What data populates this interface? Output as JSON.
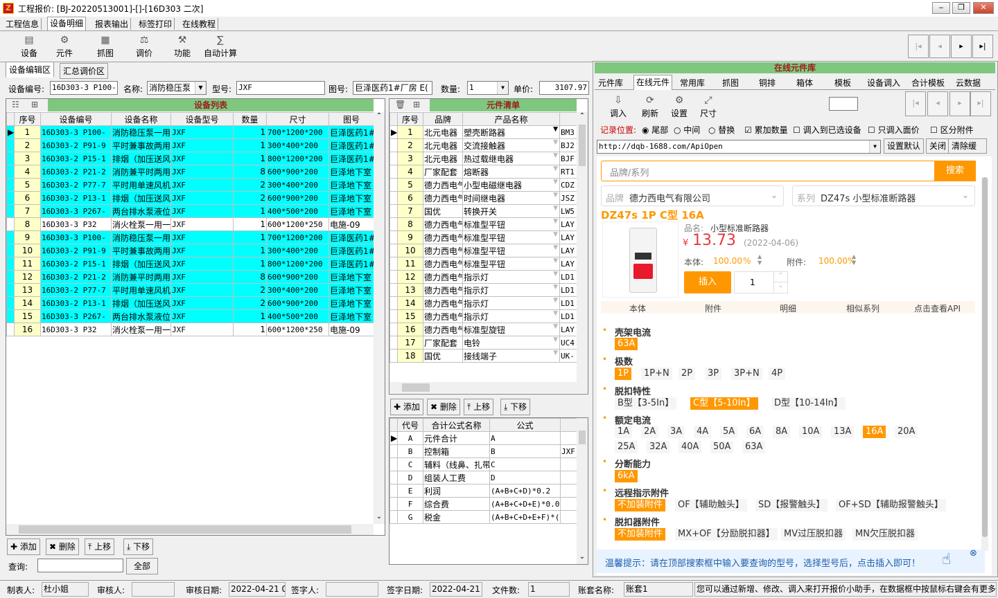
{
  "window": {
    "title": "工程报价: [BJ-20220513001]-[]-[16D303 二次]",
    "icon": "app-icon",
    "min": "‒",
    "max": "❐",
    "close": "✕"
  },
  "menu": [
    "工程信息",
    "设备明细",
    "报表输出",
    "标签打印",
    "在线教程"
  ],
  "toolbar": {
    "left": [
      {
        "label": "设备",
        "icon": "device-icon"
      },
      {
        "label": "元件",
        "icon": "component-icon"
      },
      {
        "label": "抓图",
        "icon": "capture-icon"
      },
      {
        "label": "调价",
        "icon": "adjust-price-icon"
      },
      {
        "label": "功能",
        "icon": "function-icon"
      },
      {
        "label": "自动计算",
        "icon": "auto-calc-icon"
      }
    ],
    "nav": [
      "|◂",
      "◂",
      "▸",
      "▸|"
    ]
  },
  "left_tabs": [
    "设备编辑区",
    "汇总调价区"
  ],
  "form": {
    "code_label": "设备编号:",
    "code_value": "16D303-3 P100-",
    "name_label": "名称:",
    "name_value": "消防稳压泵",
    "model_label": "型号:",
    "model_value": "JXF",
    "drawing_label": "图号:",
    "drawing_value": "巨泽医药1#厂房 E(",
    "qty_label": "数量:",
    "qty_value": "1",
    "price_label": "单价:",
    "price_value": "3107.97"
  },
  "device_list": {
    "title": "设备列表",
    "headers": [
      "序号",
      "设备编号",
      "设备名称",
      "设备型号",
      "数量",
      "尺寸",
      "图号"
    ],
    "rows": [
      {
        "c": "cy",
        "v": [
          "1",
          "16D303-3 P100-",
          "消防稳压泵一用",
          "JXF",
          "1",
          "700*1200*200",
          "巨泽医药1#"
        ]
      },
      {
        "c": "cy",
        "v": [
          "2",
          "16D303-2 P91-9",
          "平时兼事故两用",
          "JXF",
          "1",
          "300*400*200",
          "巨泽医药1#"
        ]
      },
      {
        "c": "cy",
        "v": [
          "3",
          "16D303-2 P15-1",
          "排烟（加压送风",
          "JXF",
          "1",
          "800*1200*200",
          "巨泽医药1#"
        ]
      },
      {
        "c": "cy",
        "v": [
          "4",
          "16D303-2 P21-2",
          "消防兼平时两用",
          "JXF",
          "8",
          "600*900*200",
          "巨泽地下室"
        ]
      },
      {
        "c": "cy",
        "v": [
          "5",
          "16D303-2 P77-7",
          "平时用单速风机",
          "JXF",
          "2",
          "300*400*200",
          "巨泽地下室"
        ]
      },
      {
        "c": "cy",
        "v": [
          "6",
          "16D303-2 P13-1",
          "排烟（加压送风",
          "JXF",
          "2",
          "600*900*200",
          "巨泽地下室"
        ]
      },
      {
        "c": "cy",
        "v": [
          "7",
          "16D303-3 P267-",
          "两台排水泵液位",
          "JXF",
          "1",
          "400*500*200",
          "巨泽地下室"
        ]
      },
      {
        "c": "wh",
        "v": [
          "8",
          "16D303-3 P32",
          "消火栓泵一用一",
          "JXF",
          "1",
          "600*1200*250",
          "电施-09"
        ]
      },
      {
        "c": "cy",
        "v": [
          "9",
          "16D303-3 P100-",
          "消防稳压泵一用",
          "JXF",
          "1",
          "700*1200*200",
          "巨泽医药1#"
        ]
      },
      {
        "c": "cy",
        "v": [
          "10",
          "16D303-2 P91-9",
          "平时兼事故两用",
          "JXF",
          "1",
          "300*400*200",
          "巨泽医药1#"
        ]
      },
      {
        "c": "cy",
        "v": [
          "11",
          "16D303-2 P15-1",
          "排烟（加压送风",
          "JXF",
          "1",
          "800*1200*200",
          "巨泽医药1#"
        ]
      },
      {
        "c": "cy",
        "v": [
          "12",
          "16D303-2 P21-2",
          "消防兼平时两用",
          "JXF",
          "8",
          "600*900*200",
          "巨泽地下室"
        ]
      },
      {
        "c": "cy",
        "v": [
          "13",
          "16D303-2 P77-7",
          "平时用单速风机",
          "JXF",
          "2",
          "300*400*200",
          "巨泽地下室"
        ]
      },
      {
        "c": "cy",
        "v": [
          "14",
          "16D303-2 P13-1",
          "排烟（加压送风",
          "JXF",
          "2",
          "600*900*200",
          "巨泽地下室"
        ]
      },
      {
        "c": "cy",
        "v": [
          "15",
          "16D303-3 P267-",
          "两台排水泵液位",
          "JXF",
          "1",
          "400*500*200",
          "巨泽地下室"
        ]
      },
      {
        "c": "wh",
        "v": [
          "16",
          "16D303-3 P32",
          "消火栓泵一用一",
          "JXF",
          "1",
          "600*1200*250",
          "电施-09"
        ]
      }
    ]
  },
  "left_buttons": [
    "添加",
    "删除",
    "上移",
    "下移"
  ],
  "query": {
    "label": "查询:",
    "value": "",
    "all": "全部"
  },
  "component_list": {
    "title": "元件清单",
    "headers": [
      "序号",
      "品牌",
      "产品名称",
      ""
    ],
    "rows": [
      [
        "1",
        "北元电器",
        "塑壳断路器",
        "BM3"
      ],
      [
        "2",
        "北元电器",
        "交流接触器",
        "BJ2"
      ],
      [
        "3",
        "北元电器",
        "热过载继电器",
        "BJF"
      ],
      [
        "4",
        "厂家配套",
        "熔断器",
        "RT1"
      ],
      [
        "5",
        "德力西电气",
        "小型电磁继电器",
        "CDZ"
      ],
      [
        "6",
        "德力西电气",
        "时间继电器",
        "JSZ"
      ],
      [
        "7",
        "国优",
        "转换开关",
        "LW5"
      ],
      [
        "8",
        "德力西电气",
        "标准型平钮",
        "LAY"
      ],
      [
        "9",
        "德力西电气",
        "标准型平钮",
        "LAY"
      ],
      [
        "10",
        "德力西电气",
        "标准型平钮",
        "LAY"
      ],
      [
        "11",
        "德力西电气",
        "标准型平钮",
        "LAY"
      ],
      [
        "12",
        "德力西电气",
        "指示灯",
        "LD1"
      ],
      [
        "13",
        "德力西电气",
        "指示灯",
        "LD1"
      ],
      [
        "14",
        "德力西电气",
        "指示灯",
        "LD1"
      ],
      [
        "15",
        "德力西电气",
        "指示灯",
        "LD1"
      ],
      [
        "16",
        "德力西电气",
        "标准型旋钮",
        "LAY"
      ],
      [
        "17",
        "厂家配套",
        "电铃",
        "UC4"
      ],
      [
        "18",
        "国优",
        "接线端子",
        "UK-"
      ]
    ]
  },
  "mid_buttons": [
    "添加",
    "删除",
    "上移",
    "下移"
  ],
  "formula_list": {
    "headers": [
      "代号",
      "合计公式名称",
      "公式",
      ""
    ],
    "rows": [
      [
        "A",
        "元件合计",
        "A",
        ""
      ],
      [
        "B",
        "控制箱",
        "B",
        "JXF"
      ],
      [
        "C",
        "辅料（线鼻、扎带",
        "C",
        ""
      ],
      [
        "D",
        "组装人工费",
        "D",
        ""
      ],
      [
        "E",
        "利润",
        "(A+B+C+D)*0.2",
        ""
      ],
      [
        "F",
        "综合费",
        "(A+B+C+D+E)*0.0",
        ""
      ],
      [
        "G",
        "税金",
        "(A+B+C+D+E+F)*(",
        ""
      ]
    ]
  },
  "online": {
    "title": "在线元件库",
    "tabs": [
      "元件库",
      "在线元件",
      "常用库",
      "抓图",
      "铜排",
      "箱体",
      "模板",
      "设备调入",
      "合计模板",
      "云数据"
    ],
    "tools": [
      "调入",
      "刷新",
      "设置",
      "尺寸"
    ],
    "record_label": "记录位置:",
    "opts": [
      "尾部",
      "中间",
      "替换",
      "累加数量",
      "调入到已选设备",
      "只调入面价",
      "区分附件"
    ],
    "url": "http://dqb-1688.com/ApiOpen",
    "url_btns": [
      "设置默认",
      "关闭",
      "清除缓存"
    ]
  },
  "web": {
    "search_placeholder": "品牌/系列",
    "search_btn": "搜索",
    "brand_label": "品牌",
    "brand_value": "德力西电气有限公司",
    "series_label": "系列",
    "series_value": "DZ47s 小型标准断路器",
    "product_title": "DZ47s 1P C型 16A",
    "pname_label": "品名:",
    "pname_value": "小型标准断路器",
    "price_symbol": "¥",
    "price": "13.73",
    "price_date": "(2022-04-06)",
    "body_label": "本体:",
    "body_pct": "100.00",
    "attach_label": "附件:",
    "attach_pct": "100.00",
    "pct": "%",
    "insert_btn": "插入",
    "qty": "1",
    "tabs": [
      "本体",
      "附件",
      "明细",
      "相似系列",
      "点击查看API"
    ],
    "specs": [
      {
        "title": "壳架电流",
        "opts": [
          {
            "t": "63A",
            "on": true
          }
        ]
      },
      {
        "title": "极数",
        "opts": [
          {
            "t": "1P",
            "on": true
          },
          {
            "t": "1P+N"
          },
          {
            "t": "2P"
          },
          {
            "t": "3P"
          },
          {
            "t": "3P+N"
          },
          {
            "t": "4P"
          }
        ]
      },
      {
        "title": "脱扣特性",
        "opts": [
          {
            "t": "B型【3-5In】"
          },
          {
            "t": "C型【5-10In】",
            "on": true
          },
          {
            "t": "D型【10-14In】"
          }
        ]
      },
      {
        "title": "额定电流",
        "opts": [
          {
            "t": "1A"
          },
          {
            "t": "2A"
          },
          {
            "t": "3A"
          },
          {
            "t": "4A"
          },
          {
            "t": "5A"
          },
          {
            "t": "6A"
          },
          {
            "t": "8A"
          },
          {
            "t": "10A"
          },
          {
            "t": "13A"
          },
          {
            "t": "16A",
            "on": true
          },
          {
            "t": "20A"
          },
          {
            "t": "25A"
          },
          {
            "t": "32A"
          },
          {
            "t": "40A"
          },
          {
            "t": "50A"
          },
          {
            "t": "63A"
          }
        ]
      },
      {
        "title": "分断能力",
        "opts": [
          {
            "t": "6kA",
            "on": true
          }
        ]
      },
      {
        "title": "远程指示附件",
        "opts": [
          {
            "t": "不加装附件",
            "on": true
          },
          {
            "t": "OF【辅助触头】"
          },
          {
            "t": "SD【报警触头】"
          },
          {
            "t": "OF+SD【辅助报警触头】"
          }
        ]
      },
      {
        "title": "脱扣器附件",
        "opts": [
          {
            "t": "不加装附件",
            "on": true
          },
          {
            "t": "MX+OF【分励脱扣器】"
          },
          {
            "t": "MV过压脱扣器"
          },
          {
            "t": "MN欠压脱扣器"
          }
        ]
      }
    ],
    "tip": "温馨提示：请在顶部搜索框中输入要查询的型号，选择型号后，点击插入即可！"
  },
  "status": {
    "maker_label": "制表人:",
    "maker": "杜小姐",
    "reviewer_label": "审核人:",
    "reviewer": "",
    "review_date_label": "审核日期:",
    "review_date": "2022-04-21 0",
    "signer_label": "签字人:",
    "signer": "",
    "sign_date_label": "签字日期:",
    "sign_date": "2022-04-21",
    "files_label": "文件数:",
    "files": "1",
    "account_label": "账套名称:",
    "account": "账套1",
    "hint": "您可以通过新增、修改、调入来打开报价小助手，在数据框中按鼠标右键会有更多操作"
  }
}
